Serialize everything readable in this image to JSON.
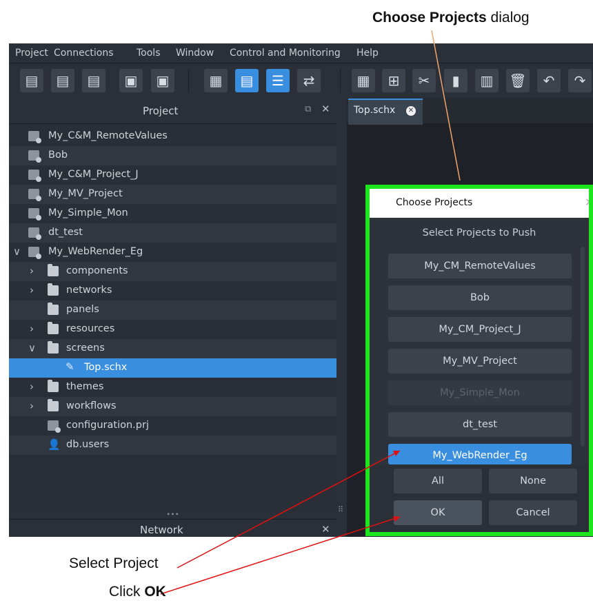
{
  "annotations": {
    "dialog_callout_bold": "Choose Projects",
    "dialog_callout_rest": " dialog",
    "select_project": "Select Project",
    "click_ok_prefix": "Click ",
    "click_ok_bold": "OK",
    "accent_line": "#f2a36b",
    "arrow_color": "#e01010",
    "highlight_color": "#1ee61e"
  },
  "menu": [
    "Project",
    "Connections",
    "Tools",
    "Window",
    "Control and Monitoring",
    "Help"
  ],
  "project_panel": {
    "title": "Project",
    "items": [
      {
        "label": "My_C&M_RemoteValues"
      },
      {
        "label": "Bob"
      },
      {
        "label": "My_C&M_Project_J"
      },
      {
        "label": "My_MV_Project"
      },
      {
        "label": "My_Simple_Mon"
      },
      {
        "label": "dt_test"
      },
      {
        "label": "My_WebRender_Eg"
      },
      {
        "label": "components"
      },
      {
        "label": "networks"
      },
      {
        "label": "panels"
      },
      {
        "label": "resources"
      },
      {
        "label": "screens"
      },
      {
        "label": "Top.schx"
      },
      {
        "label": "themes"
      },
      {
        "label": "workflows"
      },
      {
        "label": "configuration.prj"
      },
      {
        "label": "db.users"
      }
    ]
  },
  "network_panel": {
    "title": "Network"
  },
  "editor": {
    "tab_label": "Top.schx"
  },
  "dialog": {
    "title": "Choose Projects",
    "heading": "Select Projects to Push",
    "projects": [
      {
        "label": "My_CM_RemoteValues",
        "state": "normal"
      },
      {
        "label": "Bob",
        "state": "normal"
      },
      {
        "label": "My_CM_Project_J",
        "state": "normal"
      },
      {
        "label": "My_MV_Project",
        "state": "normal"
      },
      {
        "label": "My_Simple_Mon",
        "state": "disabled"
      },
      {
        "label": "dt_test",
        "state": "normal"
      },
      {
        "label": "My_WebRender_Eg",
        "state": "selected"
      }
    ],
    "all_label": "All",
    "none_label": "None",
    "ok_label": "OK",
    "cancel_label": "Cancel"
  }
}
